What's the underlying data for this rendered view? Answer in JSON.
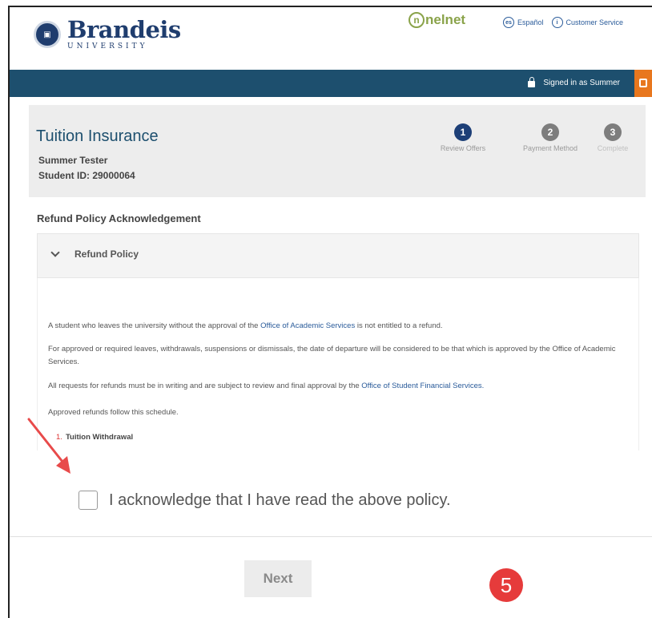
{
  "header": {
    "logo_name": "Brandeis",
    "logo_sub": "UNIVERSITY",
    "partner": "nelnet",
    "language_icon_text": "es",
    "language_link": "Español",
    "service_icon_text": "i",
    "service_link": "Customer Service"
  },
  "account_bar": {
    "signed_in": "Signed in as Summer",
    "colors": {
      "bar": "#1d4f6e",
      "exit": "#e8771e"
    }
  },
  "page": {
    "title": "Tuition Insurance",
    "student_name": "Summer Tester",
    "student_id": "Student ID: 29000064"
  },
  "steps": [
    {
      "number": "1",
      "label": "Review Offers",
      "state": "active"
    },
    {
      "number": "2",
      "label": "Payment Method",
      "state": "upcoming"
    },
    {
      "number": "3",
      "label": "Complete",
      "state": "upcoming"
    }
  ],
  "policy": {
    "heading": "Refund Policy Acknowledgement",
    "accordion_label": "Refund Policy",
    "p1_a": "A student who leaves the university without the approval of the ",
    "p1_link": "Office of Academic Services",
    "p1_b": " is not entitled to a refund.",
    "p2": "For approved or required leaves, withdrawals, suspensions or dismissals, the date of departure will be considered to be that which is approved by the Office of Academic Services.",
    "p3_a": "All requests for refunds must be in writing and are subject to review and final approval by the ",
    "p3_link": "Office of Student Financial Services.",
    "p4": "Approved refunds follow this schedule.",
    "list_num": "1.",
    "list_item": "Tuition Withdrawal"
  },
  "acknowledge": {
    "label": "I acknowledge that I have read the above policy.",
    "checked": false
  },
  "footer": {
    "next_label": "Next",
    "badge": "5"
  }
}
